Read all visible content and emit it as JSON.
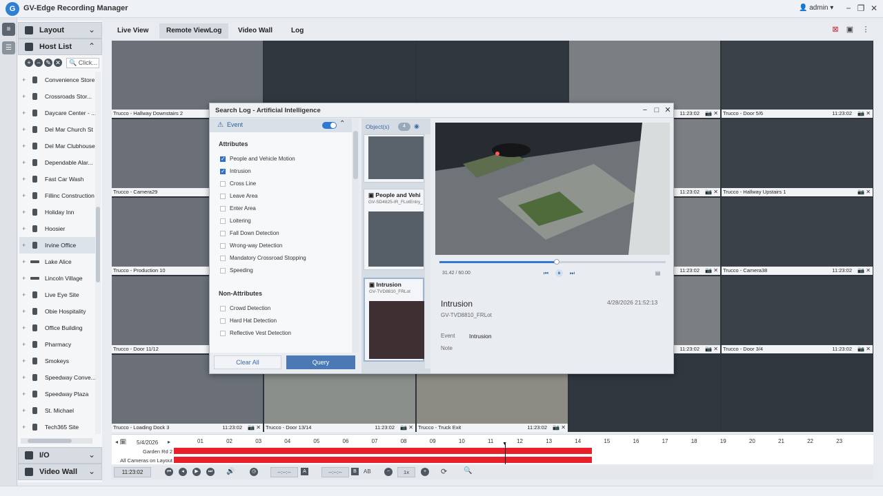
{
  "app": {
    "title": "GV-Edge Recording Manager",
    "logo_letter": "G",
    "user": "admin"
  },
  "window_controls": {
    "minimize": "−",
    "restore": "❐",
    "close": "✕"
  },
  "sidebar": {
    "layout_label": "Layout",
    "hostlist_label": "Host List",
    "search_placeholder": "Click...",
    "hosts": [
      {
        "name": "Convenience Store",
        "icon": "camera-host-icon"
      },
      {
        "name": "Crossroads Stor...",
        "icon": "camera-host-icon"
      },
      {
        "name": "Daycare Center - ...",
        "icon": "camera-host-icon"
      },
      {
        "name": "Del Mar Church St",
        "icon": "camera-host-icon"
      },
      {
        "name": "Del Mar Clubhouse",
        "icon": "camera-host-icon"
      },
      {
        "name": "Dependable Alar...",
        "icon": "camera-host-icon"
      },
      {
        "name": "Fast Car Wash",
        "icon": "camera-host-icon"
      },
      {
        "name": "Fillinc Construction",
        "icon": "camera-host-icon"
      },
      {
        "name": "Holiday Inn",
        "icon": "camera-host-icon"
      },
      {
        "name": "Hoosier",
        "icon": "camera-host-icon"
      },
      {
        "name": "Irvine Office",
        "icon": "camera-host-icon"
      },
      {
        "name": "Lake Alice",
        "icon": "nvr-host-icon"
      },
      {
        "name": "Lincoln Village",
        "icon": "nvr-host-icon"
      },
      {
        "name": "Live Eye Site",
        "icon": "camera-host-icon"
      },
      {
        "name": "Obie Hospitality",
        "icon": "camera-host-icon"
      },
      {
        "name": "Office Building",
        "icon": "camera-host-icon"
      },
      {
        "name": "Pharmacy",
        "icon": "camera-host-icon"
      },
      {
        "name": "Smokeys",
        "icon": "camera-host-icon"
      },
      {
        "name": "Speedway Conve...",
        "icon": "camera-host-icon"
      },
      {
        "name": "Speedway Plaza",
        "icon": "camera-host-icon"
      },
      {
        "name": "St. Michael",
        "icon": "camera-host-icon"
      },
      {
        "name": "Tech365 Site",
        "icon": "camera-host-icon"
      }
    ],
    "io_label": "I/O",
    "videowall_label": "Video Wall"
  },
  "tabs": [
    {
      "label": "Live View"
    },
    {
      "label": "Remote ViewLog"
    },
    {
      "label": "Video Wall"
    },
    {
      "label": "Log"
    }
  ],
  "cameras": [
    {
      "name": "Trucco - Hallway Downstairs 2",
      "time": ""
    },
    {
      "name": "",
      "time": ""
    },
    {
      "name": "",
      "time": ""
    },
    {
      "name": "",
      "time": "11:23:02"
    },
    {
      "name": "Trucco - Door 5/6",
      "time": "11:23:02"
    },
    {
      "name": "Trucco - Camera29",
      "time": ""
    },
    {
      "name": "",
      "time": ""
    },
    {
      "name": "",
      "time": ""
    },
    {
      "name": "",
      "time": "11:23:02"
    },
    {
      "name": "Trucco - Hallway Upstairs 1",
      "time": ""
    },
    {
      "name": "Trucco - Production 10",
      "time": ""
    },
    {
      "name": "",
      "time": ""
    },
    {
      "name": "",
      "time": ""
    },
    {
      "name": "",
      "time": "11:23:02"
    },
    {
      "name": "Trucco - Camera38",
      "time": "11:23:02"
    },
    {
      "name": "Trucco - Door 11/12",
      "time": ""
    },
    {
      "name": "",
      "time": ""
    },
    {
      "name": "",
      "time": ""
    },
    {
      "name": "",
      "time": "11:23:02"
    },
    {
      "name": "Trucco - Door 3/4",
      "time": "11:23:02"
    },
    {
      "name": "Trucco - Loading Dock 3",
      "time": "11:23:02"
    },
    {
      "name": "Trucco - Door 13/14",
      "time": "11:23:02"
    },
    {
      "name": "Trucco - Truck Exit",
      "time": "11:23:02"
    },
    {
      "name": "",
      "time": ""
    },
    {
      "name": "",
      "time": ""
    }
  ],
  "modal": {
    "title": "Search Log - Artificial Intelligence",
    "event_label": "Event",
    "attributes_head": "Attributes",
    "attributes": [
      {
        "label": "People and Vehicle Motion",
        "checked": true
      },
      {
        "label": "Intrusion",
        "checked": true
      },
      {
        "label": "Cross Line",
        "checked": false
      },
      {
        "label": "Leave Area",
        "checked": false
      },
      {
        "label": "Enter Area",
        "checked": false
      },
      {
        "label": "Loitering",
        "checked": false
      },
      {
        "label": "Fall Down Detection",
        "checked": false
      },
      {
        "label": "Wrong-way Detection",
        "checked": false
      },
      {
        "label": "Mandatory Crossroad Stopping",
        "checked": false
      },
      {
        "label": "Speeding",
        "checked": false
      }
    ],
    "non_attributes_head": "Non-Attributes",
    "non_attributes": [
      {
        "label": "Crowd Detection",
        "checked": false
      },
      {
        "label": "Hard Hat Detection",
        "checked": false
      },
      {
        "label": "Reflective Vest Detection",
        "checked": false
      }
    ],
    "clear_label": "Clear All",
    "query_label": "Query",
    "objects_label": "Object(s)",
    "objects_count": "4",
    "object_cards": [
      {
        "title": "People and Vehi",
        "sub": "GV-SD4825-IR_FLotEntry_"
      },
      {
        "title": "Intrusion",
        "sub": "GV-TVD8810_FRLot"
      }
    ],
    "player_time": "31.42 / 60.00",
    "detail": {
      "title": "Intrusion",
      "camera": "GV-TVD8810_FRLot",
      "timestamp": "4/28/2026 21:52:13",
      "event_key": "Event",
      "event_value": "Intrusion",
      "note_key": "Note"
    }
  },
  "timeline": {
    "date": "5/4/2026",
    "hours": [
      "01",
      "02",
      "03",
      "04",
      "05",
      "06",
      "07",
      "08",
      "09",
      "10",
      "11",
      "12",
      "13",
      "14",
      "15",
      "16",
      "17",
      "18",
      "19",
      "20",
      "21",
      "22",
      "23"
    ],
    "rows": [
      "Garden Rd 2",
      "All Cameras on Layout"
    ],
    "recorded_until_hour": 14.55,
    "cursor_hour": 11.55
  },
  "controls": {
    "current_time": "11:23:02",
    "start_field": "--:--:--",
    "end_field": "--:--:--",
    "speed": "1x"
  }
}
